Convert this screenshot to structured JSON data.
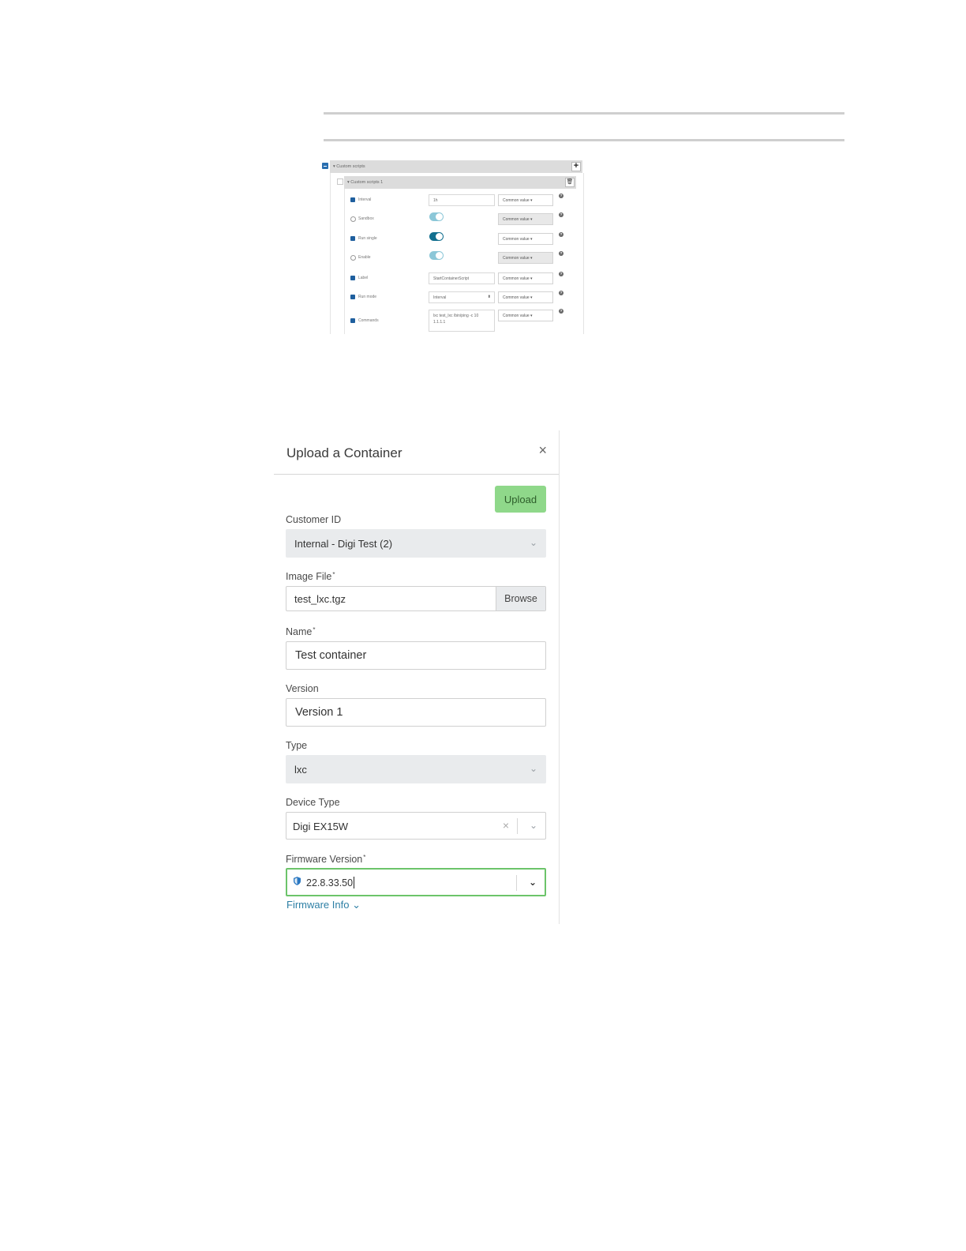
{
  "custom_scripts": {
    "header": "▾ Custom scripts",
    "sub_header": "▾ Custom scripts 1",
    "add_icon": "+",
    "delete_icon": "🗑",
    "help_icon": "?",
    "rows": [
      {
        "label": "Interval",
        "checked": true,
        "control": "input",
        "value": "1h",
        "common": "Common value ▾"
      },
      {
        "label": "Sandbox",
        "checked": false,
        "control": "toggle",
        "on": false,
        "common": "Common value ▾"
      },
      {
        "label": "Run single",
        "checked": true,
        "control": "toggle",
        "on": true,
        "common": "Common value ▾"
      },
      {
        "label": "Enable",
        "checked": false,
        "control": "toggle",
        "on": false,
        "common": "Common value ▾"
      },
      {
        "label": "Label",
        "checked": true,
        "control": "input",
        "value": "StartContainerScript",
        "common": "Common value ▾"
      },
      {
        "label": "Run mode",
        "checked": true,
        "control": "select",
        "value": "Interval",
        "common": "Common value ▾"
      },
      {
        "label": "Commands",
        "checked": true,
        "control": "textarea",
        "value": "lxc test_lxc /bin/ping -c 10 1.1.1.1",
        "common": "Common value ▾"
      }
    ]
  },
  "modal": {
    "title": "Upload a Container",
    "close": "×",
    "upload_label": "Upload",
    "customer_id": {
      "label": "Customer ID",
      "value": "Internal - Digi Test (2)"
    },
    "image_file": {
      "label": "Image File",
      "required": "*",
      "value": "test_lxc.tgz",
      "browse": "Browse"
    },
    "name": {
      "label": "Name",
      "required": "*",
      "value": "Test container"
    },
    "version": {
      "label": "Version",
      "value": "Version 1"
    },
    "type": {
      "label": "Type",
      "value": "lxc"
    },
    "device_type": {
      "label": "Device Type",
      "value": "Digi EX15W",
      "clear": "×"
    },
    "firmware_version": {
      "label": "Firmware Version",
      "required": "*",
      "value": "22.8.33.50"
    },
    "firmware_info": "Firmware Info ⌄"
  },
  "colors": {
    "upload_button": "#8fd88a",
    "focus_border": "#6cc46a",
    "toggle_on": "#126f8f",
    "toggle_off": "#8cc7d8",
    "link": "#2d7fa5"
  }
}
